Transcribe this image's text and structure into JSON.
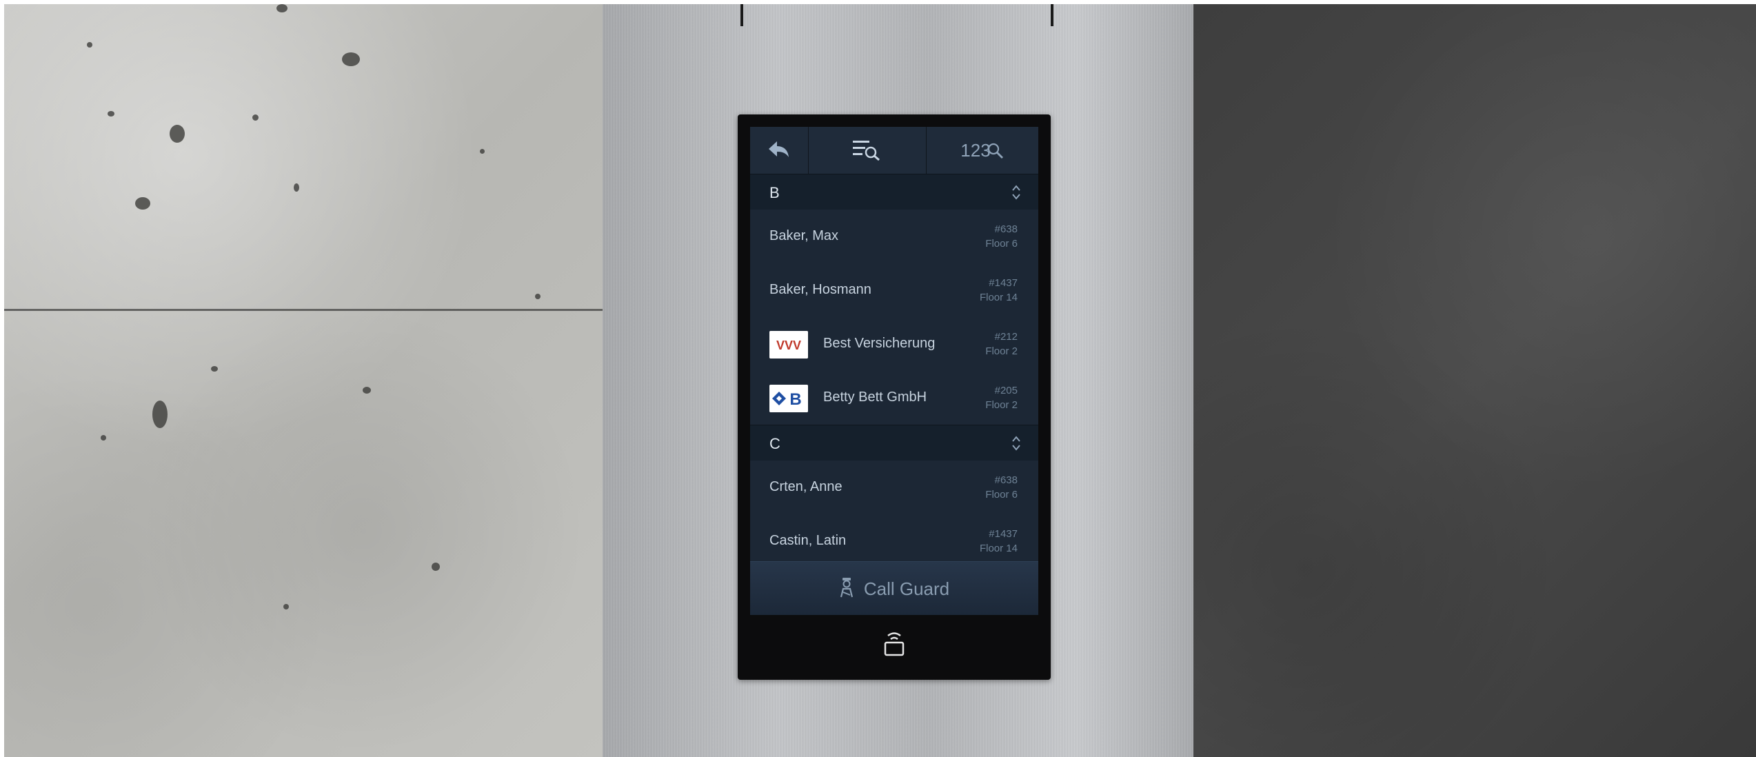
{
  "toolbar": {
    "back_icon": "back-arrow-icon",
    "list_search_icon": "list-search-icon",
    "number_search_label": "123"
  },
  "sections": [
    {
      "letter": "B",
      "entries": [
        {
          "name": "Baker, Max",
          "number": "#638",
          "floor": "Floor 6"
        },
        {
          "name": "Baker, Hosmann",
          "number": "#1437",
          "floor": "Floor 14"
        },
        {
          "name": "Best Versicherung",
          "number": "#212",
          "floor": "Floor 2",
          "logo": "VVV"
        },
        {
          "name": "Betty Bett GmbH",
          "number": "#205",
          "floor": "Floor 2",
          "logo": "B"
        }
      ]
    },
    {
      "letter": "C",
      "entries": [
        {
          "name": "Crten, Anne",
          "number": "#638",
          "floor": "Floor 6"
        },
        {
          "name": "Castin, Latin",
          "number": "#1437",
          "floor": "Floor 14"
        }
      ]
    }
  ],
  "guard": {
    "label": "Call Guard",
    "icon": "guard-person-icon"
  },
  "nfc": {
    "icon": "nfc-reader-icon"
  },
  "colors": {
    "screen_bg": "#1d2836",
    "section_bg": "#15202c",
    "text_primary": "#c7d3df",
    "text_secondary": "#6e8295"
  }
}
